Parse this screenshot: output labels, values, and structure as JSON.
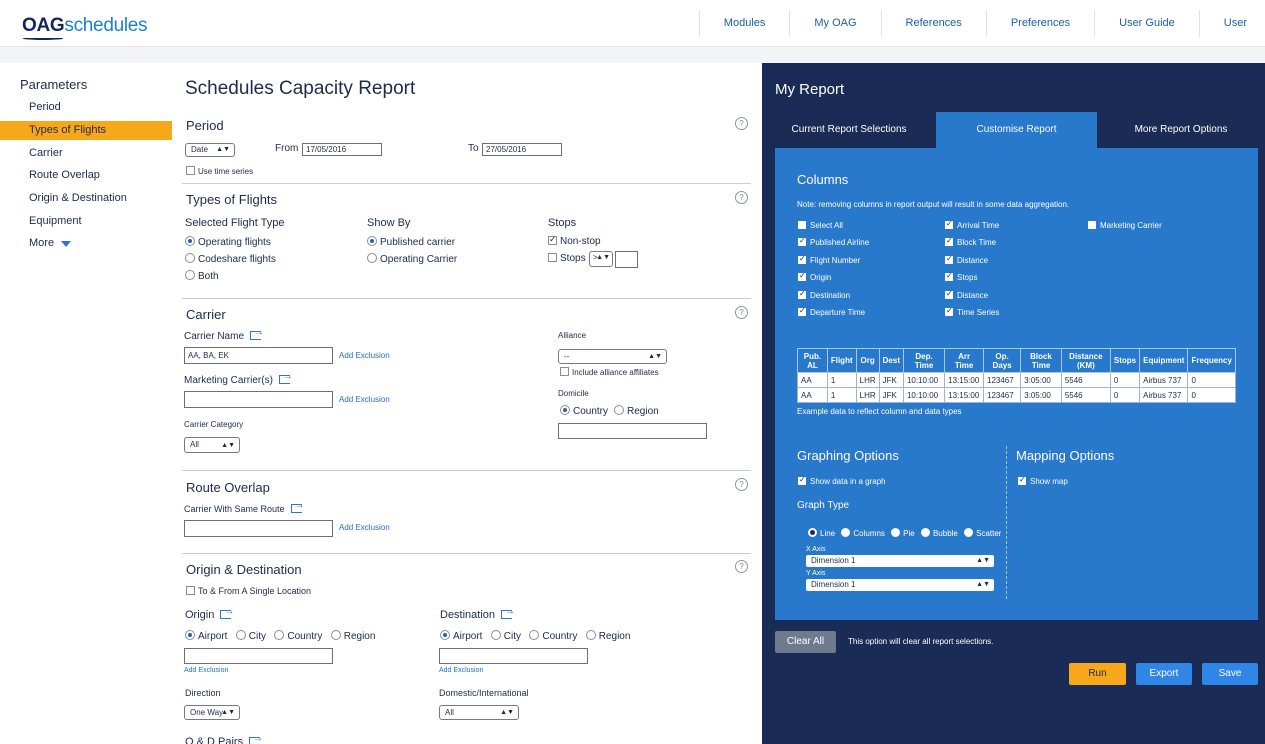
{
  "app": {
    "logo_oag": "OAG",
    "logo_schedules": "schedules"
  },
  "topnav": [
    "Modules",
    "My OAG",
    "References",
    "Preferences",
    "User Guide",
    "User"
  ],
  "sidebar": {
    "heading": "Parameters",
    "items": [
      "Period",
      "Types of Flights",
      "Carrier",
      "Route Overlap",
      "Origin & Destination",
      "Equipment"
    ],
    "more": "More"
  },
  "main": {
    "title": "Schedules Capacity Report",
    "help": "?",
    "period": {
      "title": "Period",
      "type_value": "Date",
      "from_label": "From",
      "from_value": "17/05/2016",
      "to_label": "To",
      "to_value": "27/05/2016",
      "time_series": "Use time series"
    },
    "types": {
      "title": "Types of Flights",
      "selected_label": "Selected Flight Type",
      "opt_operating": "Operating flights",
      "opt_codeshare": "Codeshare flights",
      "opt_both": "Both",
      "showby_label": "Show By",
      "opt_published": "Published carrier",
      "opt_opcarrier": "Operating Carrier",
      "stops_label": "Stops",
      "opt_nonstop": "Non-stop",
      "opt_stops": "Stops",
      "stops_op": "> "
    },
    "carrier": {
      "title": "Carrier",
      "name_label": "Carrier Name",
      "name_value": "AA, BA, EK",
      "add_exclusion": "Add Exclusion",
      "marketing_label": "Marketing Carrier(s)",
      "category_label": "Carrier Category",
      "category_value": "All",
      "alliance_label": "Alliance",
      "alliance_value": "--",
      "alliance_affiliates": "Include alliance affiliates",
      "domicile_label": "Domicile",
      "opt_country": "Country",
      "opt_region": "Region"
    },
    "route": {
      "title": "Route Overlap",
      "same_route_label": "Carrier With Same Route"
    },
    "od": {
      "title": "Origin & Destination",
      "single_location": "To & From A Single Location",
      "origin_label": "Origin",
      "destination_label": "Destination",
      "opt_airport": "Airport",
      "opt_city": "City",
      "opt_country": "Country",
      "opt_region": "Region",
      "direction_label": "Direction",
      "direction_value": "One Way",
      "domintl_label": "Domestic/International",
      "domintl_value": "All",
      "pairs_label": "O & D Pairs"
    }
  },
  "report": {
    "title": "My Report",
    "tabs": [
      "Current Report Selections",
      "Customise Report",
      "More Report Options"
    ],
    "columns_title": "Columns",
    "columns_note": "Note: removing columns in report output will result in some data aggregation.",
    "col_a": [
      "Select All",
      "Published Airline",
      "Flight Number",
      "Origin",
      "Destination",
      "Departure Time"
    ],
    "col_b": [
      "Arrival Time",
      "Block Time",
      "Distance",
      "Stops",
      "Distance",
      "Time Series"
    ],
    "col_c": [
      "Marketing Carrier"
    ],
    "table_headers": [
      "Pub. AL",
      "Flight",
      "Org",
      "Dest",
      "Dep. Time",
      "Arr Time",
      "Op. Days",
      "Block Time",
      "Distance (KM)",
      "Stops",
      "Equipment",
      "Frequency"
    ],
    "table_rows": [
      [
        "AA",
        "1",
        "LHR",
        "JFK",
        "10:10:00",
        "13:15:00",
        "123467",
        "3:05:00",
        "5546",
        "0",
        "Airbus 737",
        "0"
      ],
      [
        "AA",
        "1",
        "LHR",
        "JFK",
        "10:10:00",
        "13:15:00",
        "123467",
        "3:05:00",
        "5546",
        "0",
        "Airbus 737",
        "0"
      ]
    ],
    "table_note": "Example data to reflect column and data types",
    "graphing_title": "Graphing Options",
    "show_graph": "Show data in a graph",
    "graph_type_label": "Graph Type",
    "graph_types": [
      "Line",
      "Columns",
      "Pie",
      "Bubble",
      "Scatter"
    ],
    "x_axis_label": "X Axis",
    "x_axis_value": "Dimension 1",
    "y_axis_label": "Y Axis",
    "y_axis_value": "Dimension 1",
    "mapping_title": "Mapping Options",
    "show_map": "Show map",
    "clear_all": "Clear All",
    "clear_note": "This option will clear all report selections.",
    "run": "Run",
    "export": "Export",
    "save": "Save"
  },
  "colors": {
    "navy": "#1a2b55",
    "accent_blue": "#2878cc",
    "orange": "#f6a81a",
    "link_blue": "#1f6fd1"
  },
  "icons": {
    "expand": "expand-arrow-icon",
    "help": "help-circle-icon",
    "more": "chevron-down-icon"
  }
}
